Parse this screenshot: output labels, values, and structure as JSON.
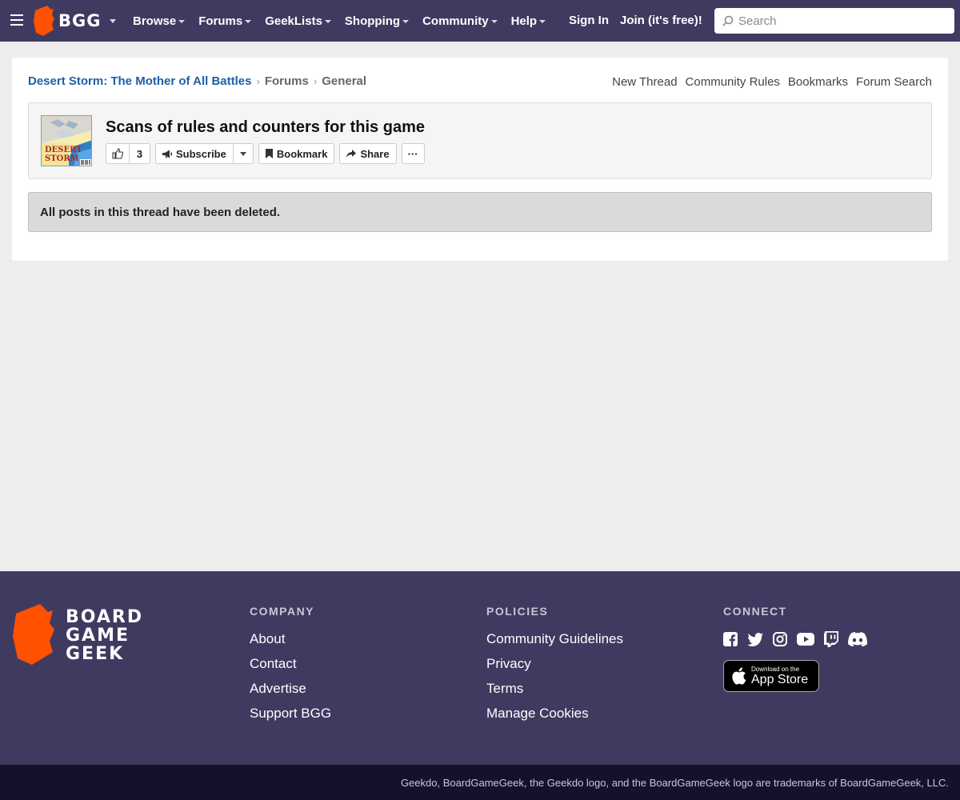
{
  "header": {
    "logo_text": "BGG",
    "nav": [
      "Browse",
      "Forums",
      "GeekLists",
      "Shopping",
      "Community",
      "Help"
    ],
    "signin": "Sign In",
    "join": "Join (it's free)!",
    "search_placeholder": "Search"
  },
  "breadcrumb": {
    "game": "Desert Storm: The Mother of All Battles",
    "forums": "Forums",
    "section": "General"
  },
  "forum_links": [
    "New Thread",
    "Community Rules",
    "Bookmarks",
    "Forum Search"
  ],
  "thread": {
    "title": "Scans of rules and counters for this game",
    "thumb_caption": "DESERT STORM",
    "likes": "3",
    "subscribe": "Subscribe",
    "bookmark": "Bookmark",
    "share": "Share",
    "more": "···"
  },
  "notice": "All posts in this thread have been deleted.",
  "footer": {
    "logo_lines": [
      "BOARD",
      "GAME",
      "GEEK"
    ],
    "company": {
      "heading": "COMPANY",
      "links": [
        "About",
        "Contact",
        "Advertise",
        "Support BGG"
      ]
    },
    "policies": {
      "heading": "POLICIES",
      "links": [
        "Community Guidelines",
        "Privacy",
        "Terms",
        "Manage Cookies"
      ]
    },
    "connect": {
      "heading": "CONNECT",
      "icons": [
        "facebook-icon",
        "twitter-icon",
        "instagram-icon",
        "youtube-icon",
        "twitch-icon",
        "discord-icon"
      ],
      "appstore_small": "Download on the",
      "appstore_big": "App Store"
    },
    "legal": "Geekdo, BoardGameGeek, the Geekdo logo, and the BoardGameGeek logo are trademarks of BoardGameGeek, LLC."
  },
  "colors": {
    "header_bg": "#3f3a60",
    "brand_orange": "#ff5100",
    "link_blue": "#1f5fa6",
    "legal_bg": "#14122b"
  }
}
